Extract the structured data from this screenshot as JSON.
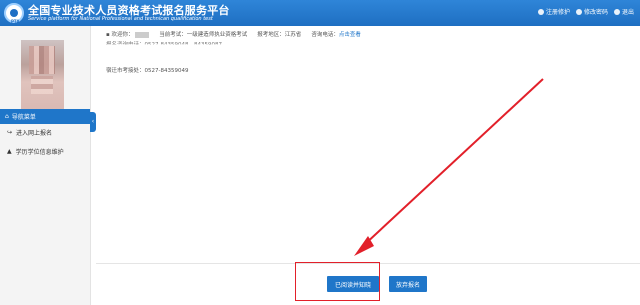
{
  "header": {
    "title": "全国专业技术人员资格考试报名服务平台",
    "subtitle": "Service platform for National Professional and technican qualification test",
    "logo_text": "PTA",
    "links": [
      {
        "label": "注册修护"
      },
      {
        "label": "修改密码"
      },
      {
        "label": "退出"
      }
    ]
  },
  "sidebar": {
    "nav_title": "导航菜单",
    "items": [
      {
        "label": "进入网上报名"
      },
      {
        "label": "学历学位信息维护"
      }
    ]
  },
  "main": {
    "welcome_label": "欢迎你：",
    "current_exam_label": "当前考试：",
    "current_exam_value": "一级建造师执业资格考试",
    "region_label": "报考地区：",
    "region_value": "江苏省",
    "consult_label": "咨询电话：",
    "consult_link": "点击查看",
    "faint_text": "报名咨询电话：0527-84359048、84359087",
    "tel_text": "宿迁市考接处：0527-84359049",
    "confirm_button": "已阅读并知晓",
    "abandon_button": "放弃报名"
  },
  "colors": {
    "brand_blue": "#1f76c9",
    "highlight_red": "#e2202a"
  }
}
